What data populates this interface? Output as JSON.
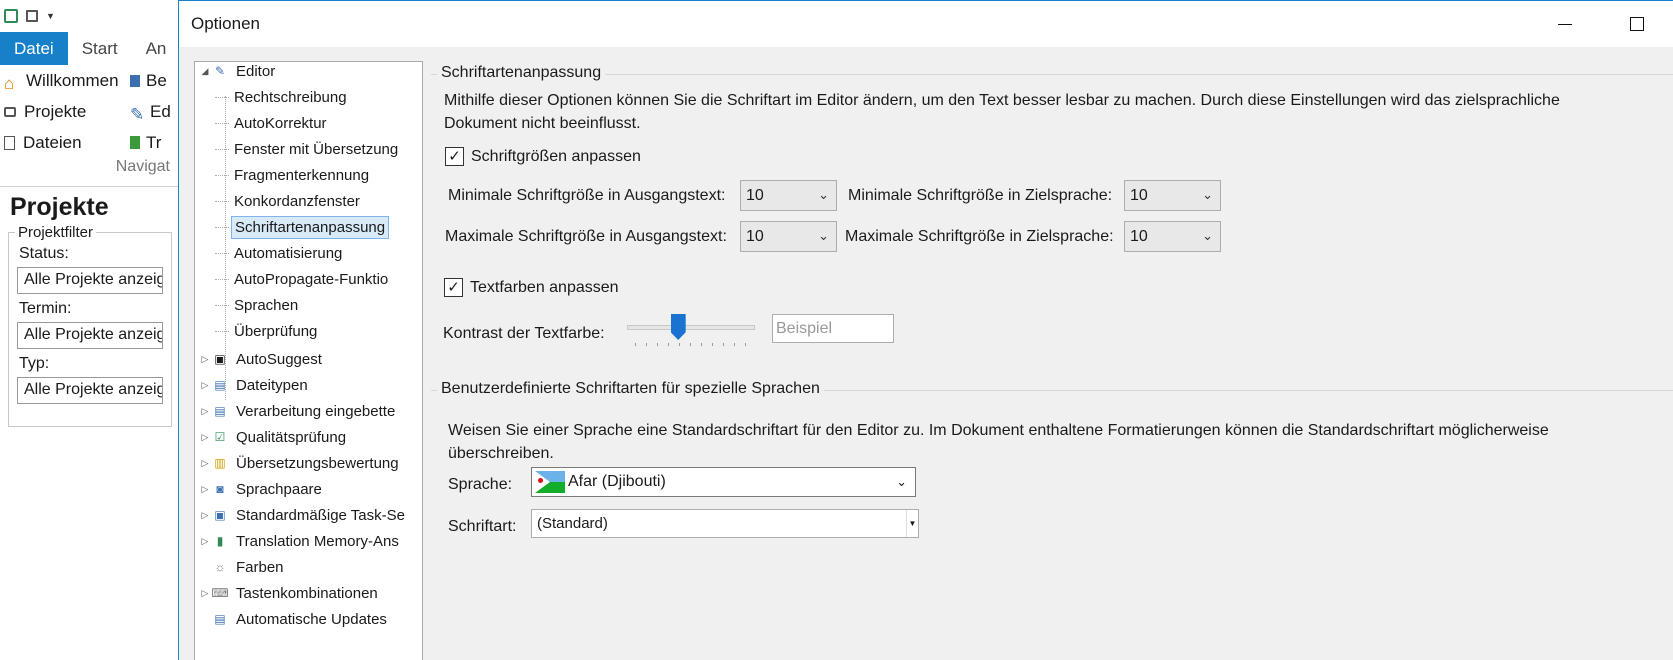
{
  "background_app": {
    "tabs": [
      "Datei",
      "Start",
      "An"
    ],
    "nav_items": [
      {
        "label": "Willkommen",
        "second": "Be"
      },
      {
        "label": "Projekte",
        "second": "Ed"
      },
      {
        "label": "Dateien",
        "second": "Tr"
      }
    ],
    "nav_group_label": "Navigat",
    "panel_title": "Projekte",
    "filter_legend": "Projektfilter",
    "filters": [
      {
        "label": "Status:",
        "value": "Alle Projekte anzeigen"
      },
      {
        "label": "Termin:",
        "value": "Alle Projekte anzeigen"
      },
      {
        "label": "Typ:",
        "value": "Alle Projekte anzeigen"
      }
    ]
  },
  "dialog": {
    "title": "Optionen",
    "tree": {
      "root": "Editor",
      "children": [
        "Rechtschreibung",
        "AutoKorrektur",
        "Fenster mit Übersetzung",
        "Fragmenterkennung",
        "Konkordanzfenster",
        "Schriftartenanpassung",
        "Automatisierung",
        "AutoPropagate-Funktio",
        "Sprachen",
        "Überprüfung"
      ],
      "selected": "Schriftartenanpassung",
      "top_level": [
        "AutoSuggest",
        "Dateitypen",
        "Verarbeitung eingebette",
        "Qualitätsprüfung",
        "Übersetzungsbewertung",
        "Sprachpaare",
        "Standardmäßige Task-Se",
        "Translation Memory-Ans",
        "Farben",
        "Tastenkombinationen",
        "Automatische Updates"
      ]
    },
    "section1": {
      "legend": "Schriftartenanpassung",
      "description": "Mithilfe dieser Optionen können Sie die Schriftart im Editor ändern, um den Text besser lesbar zu machen. Durch diese Einstellungen wird das zielsprachliche Dokument nicht beeinflusst.",
      "adjust_sizes_label": "Schriftgrößen anpassen",
      "adjust_sizes_checked": true,
      "min_source_label": "Minimale Schriftgröße in Ausgangstext:",
      "min_source_value": "10",
      "min_target_label": "Minimale Schriftgröße in Zielsprache:",
      "min_target_value": "10",
      "max_source_label": "Maximale Schriftgröße in Ausgangstext:",
      "max_source_value": "10",
      "max_target_label": "Maximale Schriftgröße in Zielsprache:",
      "max_target_value": "10",
      "adjust_colors_label": "Textfarben anpassen",
      "adjust_colors_checked": true,
      "contrast_label": "Kontrast der Textfarbe:",
      "contrast_level": 0.4,
      "sample_text": "Beispiel"
    },
    "section2": {
      "legend": "Benutzerdefinierte Schriftarten für spezielle Sprachen",
      "description": "Weisen Sie einer Sprache eine Standardschriftart für den Editor zu. Im Dokument enthaltene Formatierungen können die Standardschriftart möglicherweise überschreiben.",
      "language_label": "Sprache:",
      "language_value": "Afar (Djibouti)",
      "font_label": "Schriftart:",
      "font_value": "(Standard)"
    }
  },
  "colors": {
    "accent": "#1681c9",
    "slider_thumb": "#1a73d1",
    "selection_bg": "#d8e9f8"
  }
}
